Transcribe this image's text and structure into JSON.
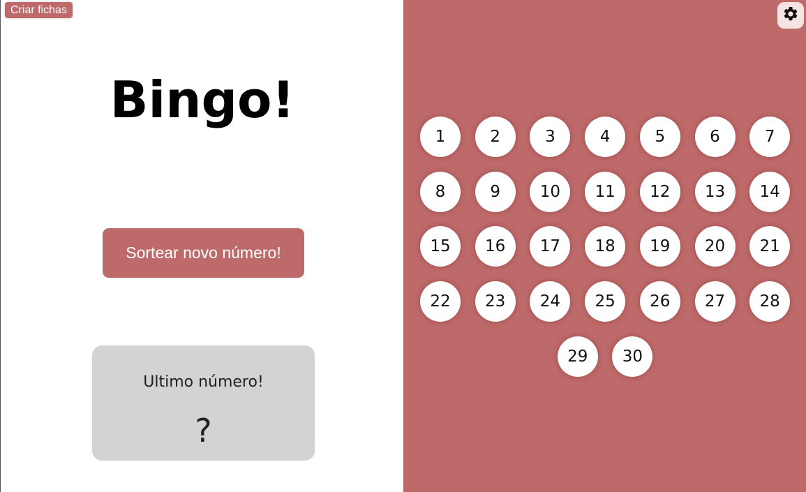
{
  "header": {
    "criar_fichas_label": "Criar fichas"
  },
  "main": {
    "title": "Bingo!",
    "draw_button_label": "Sortear novo número!",
    "last_number_label": "Ultimo número!",
    "last_number_value": "?"
  },
  "board": {
    "settings_icon": "gear-icon",
    "numbers": [
      1,
      2,
      3,
      4,
      5,
      6,
      7,
      8,
      9,
      10,
      11,
      12,
      13,
      14,
      15,
      16,
      17,
      18,
      19,
      20,
      21,
      22,
      23,
      24,
      25,
      26,
      27,
      28,
      29,
      30
    ]
  },
  "colors": {
    "accent": "#be6a6a",
    "card_background": "#d3d3d3",
    "ball_background": "#ffffff",
    "settings_background": "#f8e3e3"
  }
}
